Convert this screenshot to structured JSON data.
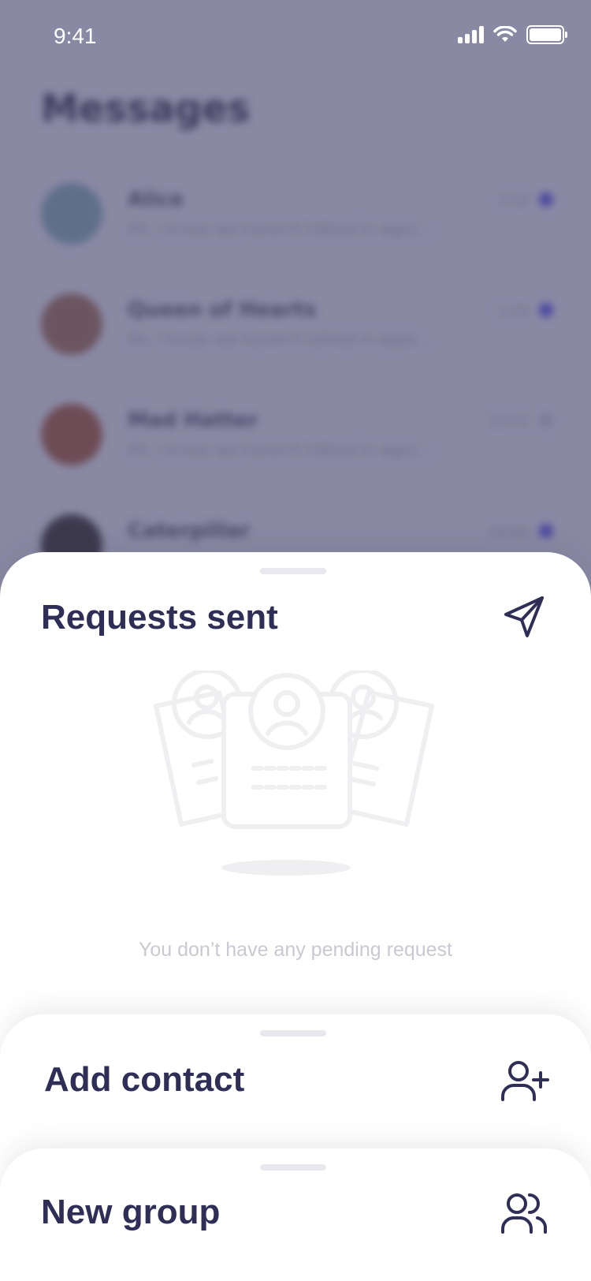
{
  "status_bar": {
    "time": "9:41"
  },
  "background": {
    "title": "Messages",
    "conversations": [
      {
        "name": "Alice",
        "preview": "Ah, I know we haven't talked in ages...",
        "time": "1:02",
        "avatar_color": "#5f6f8a"
      },
      {
        "name": "Queen of Hearts",
        "preview": "Ah, I know we haven't talked in ages...",
        "time": "1:02",
        "avatar_color": "#6b5560"
      },
      {
        "name": "Mad Hatter",
        "preview": "Ah, I know we haven't talked in ages...",
        "time": "10:01",
        "avatar_color": "#6d4c55"
      },
      {
        "name": "Caterpillar",
        "preview": "",
        "time": "10:01",
        "avatar_color": "#3d3a4e"
      }
    ]
  },
  "requests_sheet": {
    "title": "Requests sent",
    "icon": "send-icon",
    "empty_message": "You don’t have any pending request"
  },
  "add_contact_sheet": {
    "title": "Add contact",
    "icon": "add-user-icon"
  },
  "new_group_sheet": {
    "title": "New group",
    "icon": "users-icon"
  },
  "colors": {
    "accent": "#2f2e56",
    "overlay": "#8a89a4",
    "empty_text": "#c9c9d3"
  }
}
